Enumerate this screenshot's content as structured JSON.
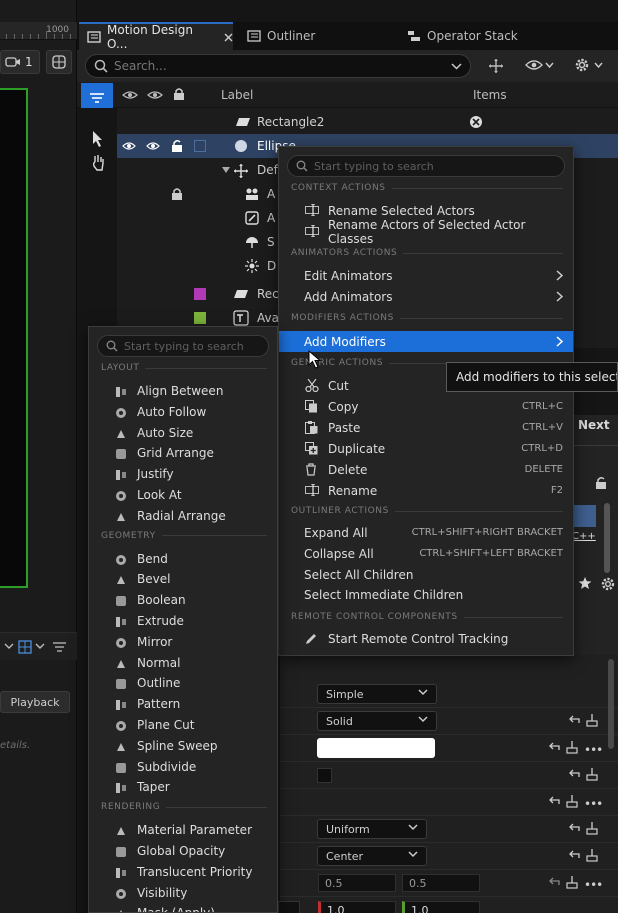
{
  "ruler": {
    "label": "1000"
  },
  "viewport": {
    "camera_count": "1"
  },
  "left_panel": {
    "playback_label": "Playback",
    "details_hint": "etails."
  },
  "tabs": [
    {
      "label": "Motion Design O...",
      "icon": "outliner-icon",
      "active": true
    },
    {
      "label": "Outliner",
      "icon": "outliner-icon",
      "active": false
    },
    {
      "label": "Operator Stack",
      "icon": "stack-icon",
      "active": false
    }
  ],
  "outliner": {
    "search_placeholder": "Search...",
    "col_label": "Label",
    "col_items": "Items",
    "rows": [
      {
        "label": "Rectangle2",
        "icon": "rectangle-icon"
      },
      {
        "label": "Ellipse",
        "icon": "ellipse-icon"
      },
      {
        "label": "Defa",
        "icon": "transform-icon"
      },
      {
        "label": "A",
        "icon": "actor-icon"
      },
      {
        "label": "A",
        "icon": "actor-icon"
      },
      {
        "label": "S",
        "icon": "actor-icon"
      },
      {
        "label": "D",
        "icon": "light-icon"
      },
      {
        "label": "Rec",
        "icon": "rectangle-icon"
      },
      {
        "label": "Ava",
        "icon": "text-icon"
      }
    ]
  },
  "next_label": "Next",
  "context_menu": {
    "search_placeholder": "Start typing to search",
    "sections": {
      "context": "CONTEXT ACTIONS",
      "animators": "ANIMATORS ACTIONS",
      "modifiers": "MODIFIERS ACTIONS",
      "generic": "GENERIC ACTIONS",
      "outliner": "OUTLINER ACTIONS",
      "remote": "REMOTE CONTROL COMPONENTS"
    },
    "items": {
      "rename_selected": "Rename Selected Actors",
      "rename_classes": "Rename Actors of Selected Actor Classes",
      "edit_animators": "Edit Animators",
      "add_animators": "Add Animators",
      "add_modifiers": "Add Modifiers",
      "cut": "Cut",
      "copy": "Copy",
      "copy_sc": "CTRL+C",
      "paste": "Paste",
      "paste_sc": "CTRL+V",
      "duplicate": "Duplicate",
      "duplicate_sc": "CTRL+D",
      "delete": "Delete",
      "delete_sc": "DELETE",
      "rename": "Rename",
      "rename_sc": "F2",
      "expand_all": "Expand All",
      "expand_sc": "CTRL+SHIFT+RIGHT BRACKET",
      "collapse_all": "Collapse All",
      "collapse_sc": "CTRL+SHIFT+LEFT BRACKET",
      "select_children": "Select All Children",
      "select_immediate": "Select Immediate Children",
      "remote_tracking": "Start Remote Control Tracking"
    }
  },
  "tooltip": "Add modifiers to this selection",
  "modifiers_submenu": {
    "search_placeholder": "Start typing to search",
    "sections": {
      "layout": "LAYOUT",
      "geometry": "GEOMETRY",
      "rendering": "RENDERING"
    },
    "layout": [
      "Align Between",
      "Auto Follow",
      "Auto Size",
      "Grid Arrange",
      "Justify",
      "Look At",
      "Radial Arrange"
    ],
    "geometry": [
      "Bend",
      "Bevel",
      "Boolean",
      "Extrude",
      "Mirror",
      "Normal",
      "Outline",
      "Pattern",
      "Plane Cut",
      "Spline Sweep",
      "Subdivide",
      "Taper"
    ],
    "rendering": [
      "Material Parameter",
      "Global Opacity",
      "Translucent Priority",
      "Visibility",
      "Mask (Apply)"
    ]
  },
  "details": {
    "dropdowns": [
      "Simple",
      "Solid",
      "Uniform",
      "Center"
    ],
    "numbers": [
      "0.5",
      "0.5",
      "1.0",
      "1.0"
    ],
    "swatch_color": "#ffffff"
  },
  "colors": {
    "accent": "#1c6fd8",
    "selection": "#2e4363",
    "viewport_border": "#2f9e27",
    "magenta_tag": "#b03ab5",
    "green_tag": "#7bb33b"
  }
}
